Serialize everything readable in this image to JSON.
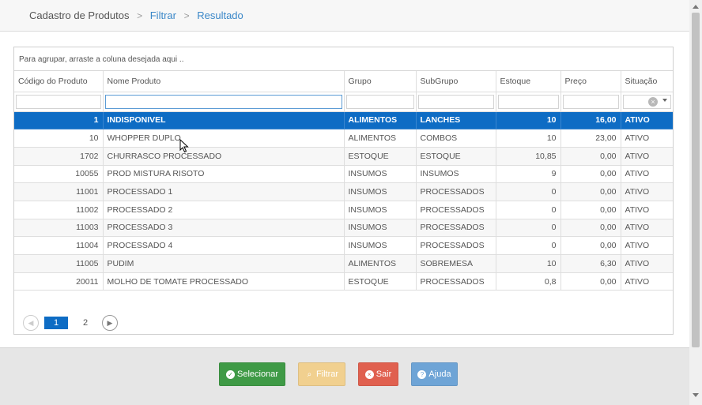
{
  "breadcrumb": {
    "root": "Cadastro de Produtos",
    "filter": "Filtrar",
    "result": "Resultado",
    "separator": ">"
  },
  "grid": {
    "group_hint": "Para agrupar, arraste a coluna desejada aqui ..",
    "columns": [
      "Código do Produto",
      "Nome Produto",
      "Grupo",
      "SubGrupo",
      "Estoque",
      "Preço",
      "Situação"
    ],
    "rows": [
      {
        "codigo": "1",
        "nome": "INDISPONIVEL",
        "grupo": "ALIMENTOS",
        "subgrupo": "LANCHES",
        "estoque": "10",
        "preco": "16,00",
        "situacao": "ATIVO"
      },
      {
        "codigo": "10",
        "nome": "WHOPPER DUPLO",
        "grupo": "ALIMENTOS",
        "subgrupo": "COMBOS",
        "estoque": "10",
        "preco": "23,00",
        "situacao": "ATIVO"
      },
      {
        "codigo": "1702",
        "nome": "CHURRASCO PROCESSADO",
        "grupo": "ESTOQUE",
        "subgrupo": "ESTOQUE",
        "estoque": "10,85",
        "preco": "0,00",
        "situacao": "ATIVO"
      },
      {
        "codigo": "10055",
        "nome": "PROD MISTURA RISOTO",
        "grupo": "INSUMOS",
        "subgrupo": "INSUMOS",
        "estoque": "9",
        "preco": "0,00",
        "situacao": "ATIVO"
      },
      {
        "codigo": "11001",
        "nome": "PROCESSADO 1",
        "grupo": "INSUMOS",
        "subgrupo": "PROCESSADOS",
        "estoque": "0",
        "preco": "0,00",
        "situacao": "ATIVO"
      },
      {
        "codigo": "11002",
        "nome": "PROCESSADO 2",
        "grupo": "INSUMOS",
        "subgrupo": "PROCESSADOS",
        "estoque": "0",
        "preco": "0,00",
        "situacao": "ATIVO"
      },
      {
        "codigo": "11003",
        "nome": "PROCESSADO 3",
        "grupo": "INSUMOS",
        "subgrupo": "PROCESSADOS",
        "estoque": "0",
        "preco": "0,00",
        "situacao": "ATIVO"
      },
      {
        "codigo": "11004",
        "nome": "PROCESSADO 4",
        "grupo": "INSUMOS",
        "subgrupo": "PROCESSADOS",
        "estoque": "0",
        "preco": "0,00",
        "situacao": "ATIVO"
      },
      {
        "codigo": "11005",
        "nome": "PUDIM",
        "grupo": "ALIMENTOS",
        "subgrupo": "SOBREMESA",
        "estoque": "10",
        "preco": "6,30",
        "situacao": "ATIVO"
      },
      {
        "codigo": "20011",
        "nome": "MOLHO DE TOMATE PROCESSADO",
        "grupo": "ESTOQUE",
        "subgrupo": "PROCESSADOS",
        "estoque": "0,8",
        "preco": "0,00",
        "situacao": "ATIVO"
      }
    ],
    "selected_row": 0
  },
  "pager": {
    "prev_icon": "chevron-left-icon",
    "next_icon": "chevron-right-icon",
    "pages": [
      "1",
      "2"
    ],
    "current_page": "1"
  },
  "buttons": {
    "select_label": "Selecionar",
    "filter_label": "Filtrar",
    "exit_label": "Sair",
    "help_label": "Ajuda"
  },
  "colors": {
    "selected_row": "#0e6cc4",
    "link": "#3a87c8",
    "select_button": "#3f9a46",
    "filter_button": "#f1d08f",
    "exit_button": "#e0604f",
    "help_button": "#6ea4d6"
  }
}
